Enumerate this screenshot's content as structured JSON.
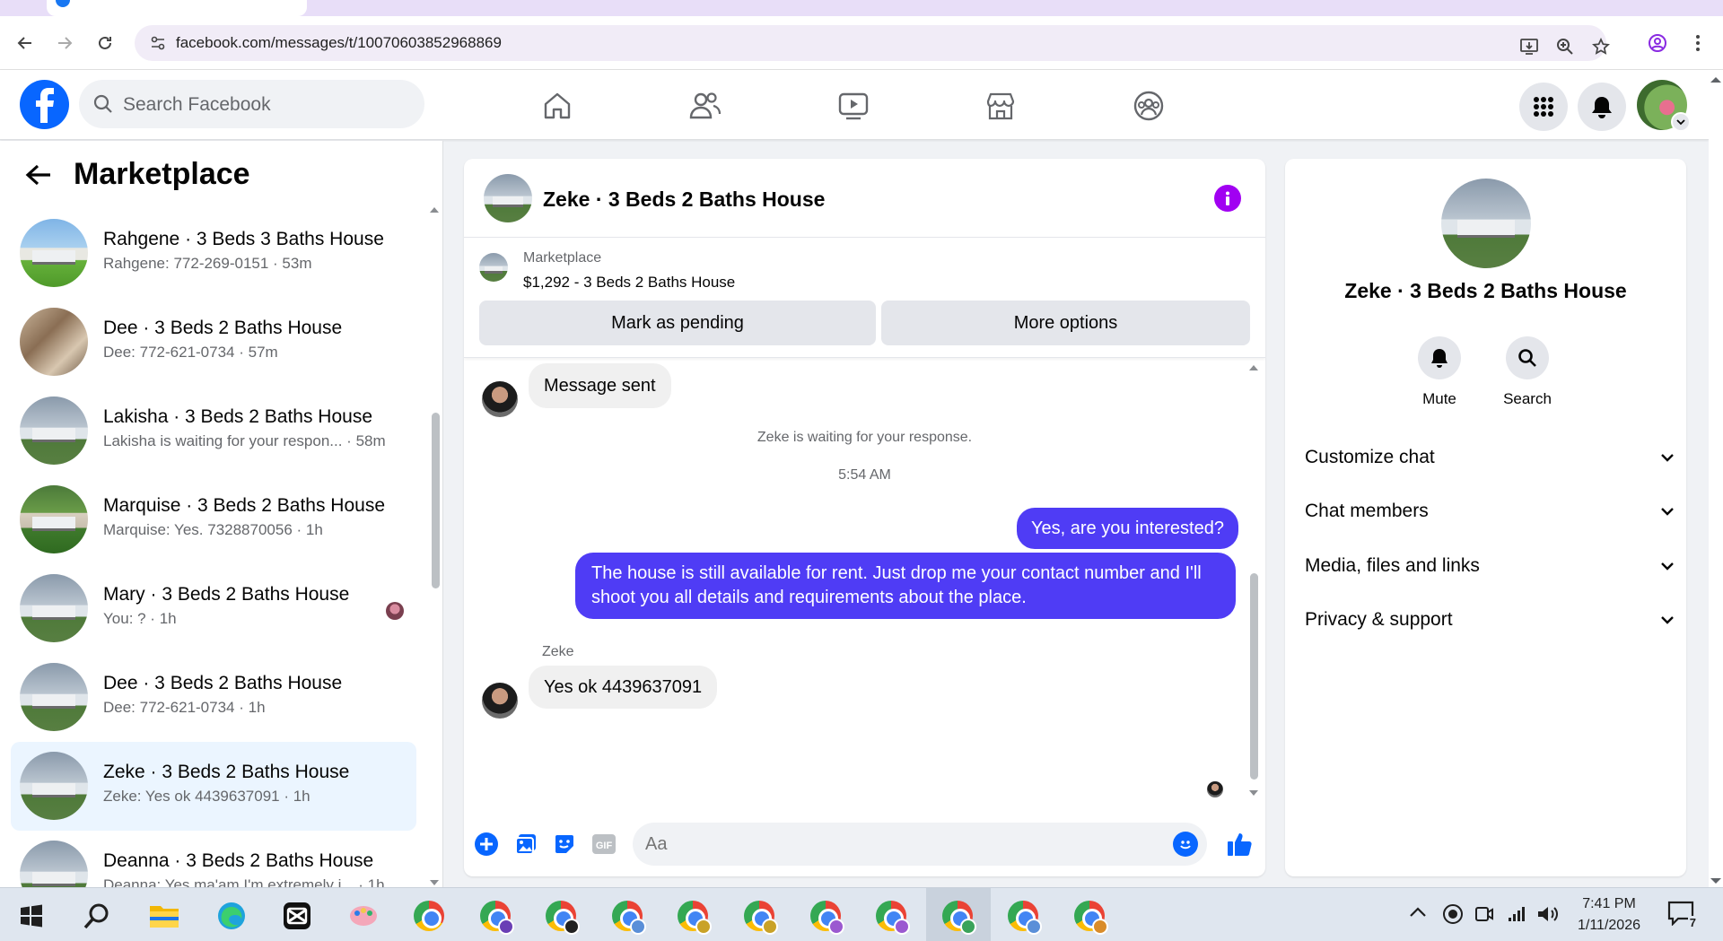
{
  "browser": {
    "url": "facebook.com/messages/t/10070603852968869"
  },
  "header": {
    "search_placeholder": "Search Facebook",
    "nav_icons": [
      "home-icon",
      "friends-icon",
      "video-icon",
      "marketplace-icon",
      "groups-icon"
    ],
    "accent": "#0866ff"
  },
  "left": {
    "title": "Marketplace",
    "conversations": [
      {
        "name": "Rahgene · 3 Beds 3 Baths House",
        "preview": "Rahgene: 772-269-0151 · 53m",
        "thumb": "green"
      },
      {
        "name": "Dee · 3 Beds 2 Baths House",
        "preview": "Dee: 772-621-0734 · 57m",
        "thumb": "interior"
      },
      {
        "name": "Lakisha · 3 Beds 2 Baths House",
        "preview": "Lakisha is waiting for your respon... · 58m",
        "thumb": "house"
      },
      {
        "name": "Marquise · 3 Beds 2 Baths House",
        "preview": "Marquise: Yes. 7328870056 · 1h",
        "thumb": "tropical"
      },
      {
        "name": "Mary · 3 Beds 2 Baths House",
        "preview": "You: ? · 1h",
        "thumb": "house"
      },
      {
        "name": "Dee · 3 Beds 2 Baths House",
        "preview": "Dee: 772-621-0734 · 1h",
        "thumb": "house"
      },
      {
        "name": "Zeke · 3 Beds 2 Baths House",
        "preview": "Zeke: Yes ok 4439637091 · 1h",
        "thumb": "house"
      },
      {
        "name": "Deanna · 3 Beds 2 Baths House",
        "preview": "Deanna: Yes ma'am I'm extremely i... · 1h",
        "thumb": "house"
      }
    ]
  },
  "chat": {
    "title": "Zeke · 3 Beds 2 Baths House",
    "listing_label": "Marketplace",
    "listing_price": "$1,292 - 3 Beds 2 Baths House",
    "mark_pending": "Mark as pending",
    "more_options": "More options",
    "msg_sent": "Message sent",
    "waiting_note": "Zeke is waiting for your response.",
    "timestamp": "5:54 AM",
    "out_1": "Yes, are you interested?",
    "out_2": "The house is still available for rent. Just drop me your contact number and I'll shoot you all details and requirements about the place.",
    "sender": "Zeke",
    "in_reply": "Yes ok 4439637091",
    "composer_placeholder": "Aa",
    "bubble_color": "#4f3cf5"
  },
  "right": {
    "name": "Zeke · 3 Beds 2 Baths House",
    "mute": "Mute",
    "search": "Search",
    "sections": [
      "Customize chat",
      "Chat members",
      "Media, files and links",
      "Privacy & support"
    ]
  },
  "taskbar": {
    "time": "7:41 PM",
    "date": "1/11/2026",
    "notification_count": "7"
  }
}
